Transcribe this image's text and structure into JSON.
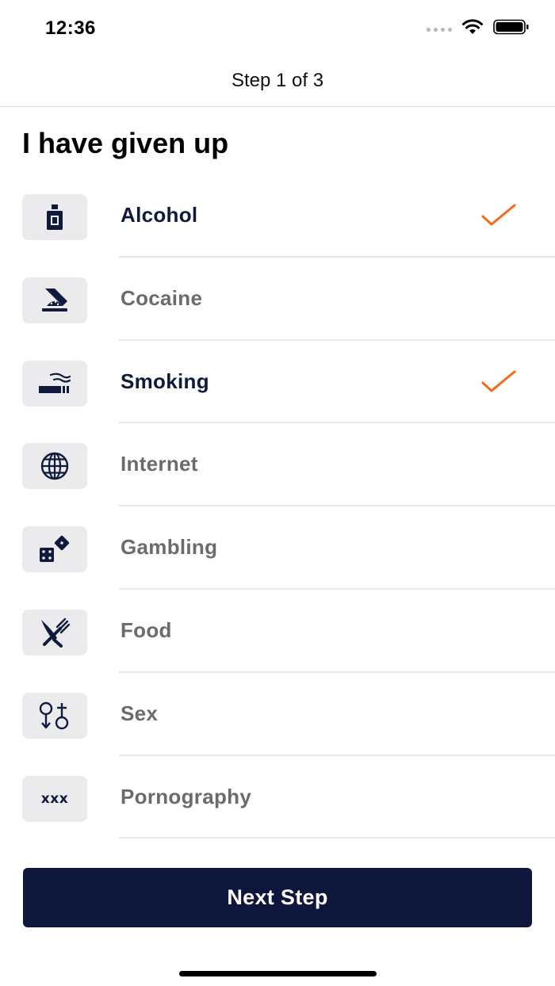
{
  "status_bar": {
    "time": "12:36"
  },
  "nav": {
    "title": "Step 1 of 3"
  },
  "page": {
    "title": "I have given up"
  },
  "items": [
    {
      "label": "Alcohol",
      "icon": "bottle-icon",
      "selected": true
    },
    {
      "label": "Cocaine",
      "icon": "razor-powder-icon",
      "selected": false
    },
    {
      "label": "Smoking",
      "icon": "cigarette-icon",
      "selected": true
    },
    {
      "label": "Internet",
      "icon": "globe-icon",
      "selected": false
    },
    {
      "label": "Gambling",
      "icon": "dice-icon",
      "selected": false
    },
    {
      "label": "Food",
      "icon": "fork-knife-icon",
      "selected": false
    },
    {
      "label": "Sex",
      "icon": "gender-symbols-icon",
      "selected": false
    },
    {
      "label": "Pornography",
      "icon": "xxx-icon",
      "icon_text": "xxx",
      "selected": false
    }
  ],
  "next_button": {
    "label": "Next Step"
  },
  "colors": {
    "accent": "#f26b1d",
    "navy": "#0e163b",
    "unselected_text": "#6b6b6b",
    "icon_bg": "#ebebed"
  }
}
